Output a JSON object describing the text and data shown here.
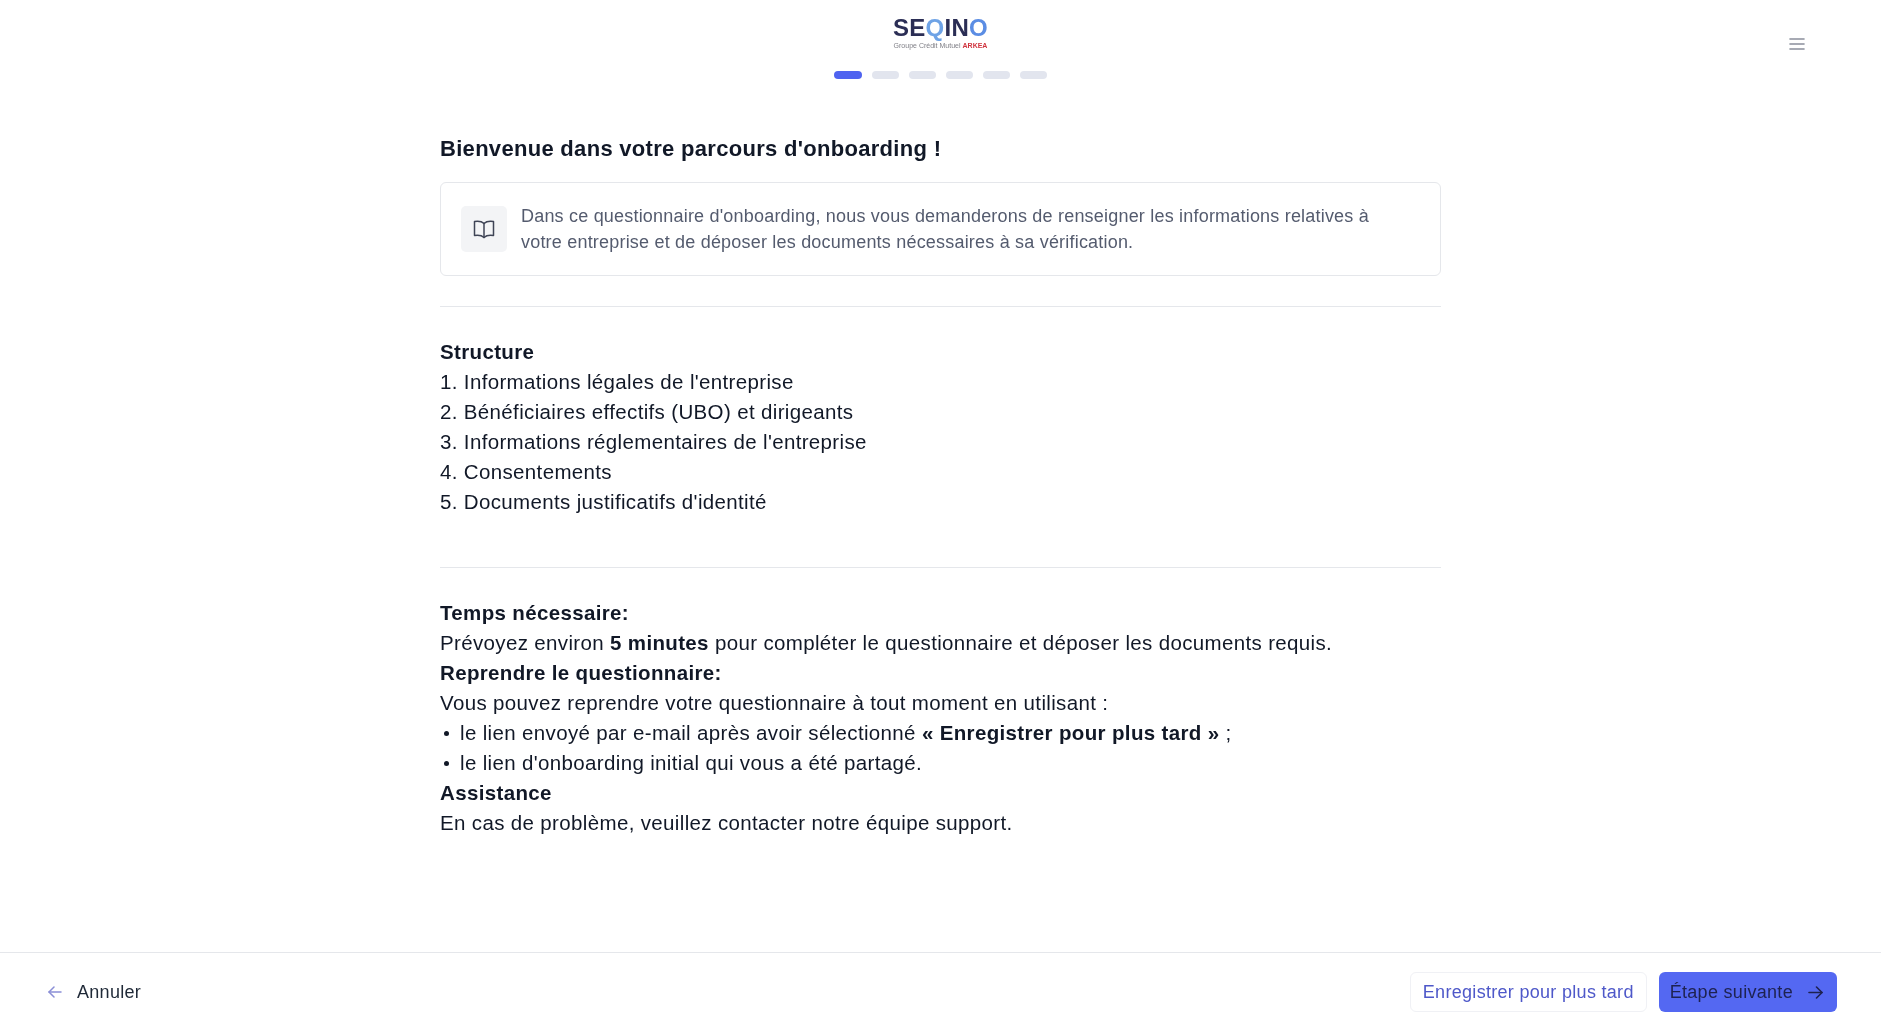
{
  "header": {
    "logo": {
      "wordmark": [
        {
          "text": "SE",
          "color": "#2b2e55"
        },
        {
          "text": "Q",
          "color": "#6ea3e6"
        },
        {
          "text": "IN",
          "color": "#2b2e55"
        },
        {
          "text": "O",
          "color": "#5b8de4"
        }
      ],
      "group": "Groupe Crédit Mutuel",
      "brand": "ARKEA"
    },
    "steps": [
      {
        "selected": true
      },
      {
        "selected": false
      },
      {
        "selected": false
      },
      {
        "selected": false
      },
      {
        "selected": false
      },
      {
        "selected": false
      }
    ]
  },
  "intro": {
    "title": "Bienvenue dans votre parcours d'onboarding !",
    "notice": "Dans ce questionnaire d'onboarding, nous vous demanderons de renseigner les informations relatives à votre entreprise et de déposer les documents nécessaires à sa vérification."
  },
  "sections": [
    {
      "blocks": [
        {
          "kind": "heading",
          "text": "Structure"
        },
        {
          "kind": "numbered",
          "text": "1. Informations légales de l'entreprise"
        },
        {
          "kind": "numbered",
          "text": "2. Bénéficiaires effectifs (UBO) et dirigeants"
        },
        {
          "kind": "numbered",
          "text": "3. Informations réglementaires de l'entreprise"
        },
        {
          "kind": "numbered",
          "text": "4. Consentements"
        },
        {
          "kind": "numbered",
          "text": "5. Documents justificatifs d'identité"
        }
      ]
    },
    {
      "blocks": [
        {
          "kind": "heading",
          "text": "Temps nécessaire:"
        },
        {
          "kind": "paragraph",
          "text": "Prévoyez environ **5 minutes** pour compléter le questionnaire et déposer les documents requis."
        },
        {
          "kind": "heading",
          "text": "Reprendre le questionnaire:"
        },
        {
          "kind": "paragraph",
          "text": "Vous pouvez reprendre votre questionnaire à tout moment en utilisant :"
        },
        {
          "kind": "bullet",
          "text": "le lien envoyé par e-mail après avoir sélectionné **« Enregistrer pour plus tard »** ;"
        },
        {
          "kind": "bullet",
          "text": "le lien d'onboarding initial qui vous a été partagé."
        },
        {
          "kind": "heading",
          "text": "Assistance"
        },
        {
          "kind": "paragraph",
          "text": "En cas de problème, veuillez contacter notre équipe support."
        }
      ]
    }
  ],
  "footer": {
    "cancel": "Annuler",
    "save_later": "Enregistrer pour plus tard",
    "next": "Étape suivante"
  }
}
